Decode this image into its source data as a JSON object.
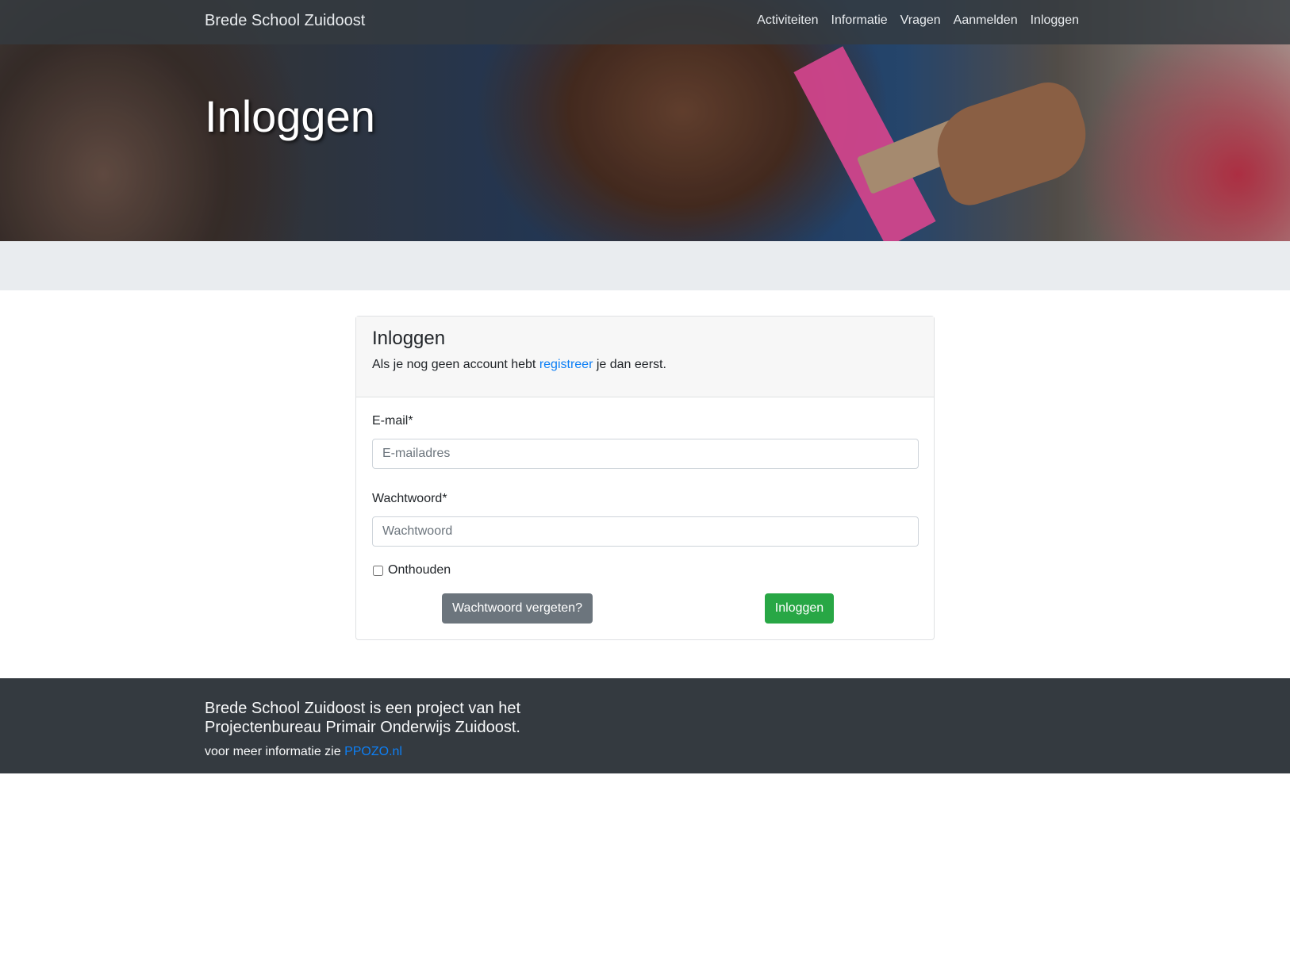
{
  "navbar": {
    "brand": "Brede School Zuidoost",
    "links": [
      {
        "label": "Activiteiten"
      },
      {
        "label": "Informatie"
      },
      {
        "label": "Vragen"
      },
      {
        "label": "Aanmelden"
      },
      {
        "label": "Inloggen"
      }
    ]
  },
  "hero": {
    "title": "Inloggen"
  },
  "login_card": {
    "title": "Inloggen",
    "subtitle_before": "Als je nog geen account hebt ",
    "subtitle_link": "registreer",
    "subtitle_after": " je dan eerst.",
    "email_label": "E-mail*",
    "email_placeholder": "E-mailadres",
    "email_value": "",
    "password_label": "Wachtwoord*",
    "password_placeholder": "Wachtwoord",
    "password_value": "",
    "remember_label": "Onthouden",
    "remember_checked": false,
    "forgot_button": "Wachtwoord vergeten?",
    "login_button": "Inloggen"
  },
  "footer": {
    "line1": "Brede School Zuidoost is een project van het",
    "line2": "Projectenbureau Primair Onderwijs Zuidoost.",
    "info_text": "voor meer informatie zie ",
    "info_link": "PPOZO.nl"
  },
  "colors": {
    "navbar_bg": "#343a40",
    "link_blue": "#0d7ff5",
    "success_green": "#28a745",
    "secondary_grey": "#6c757d",
    "band_grey": "#e9ecef"
  }
}
